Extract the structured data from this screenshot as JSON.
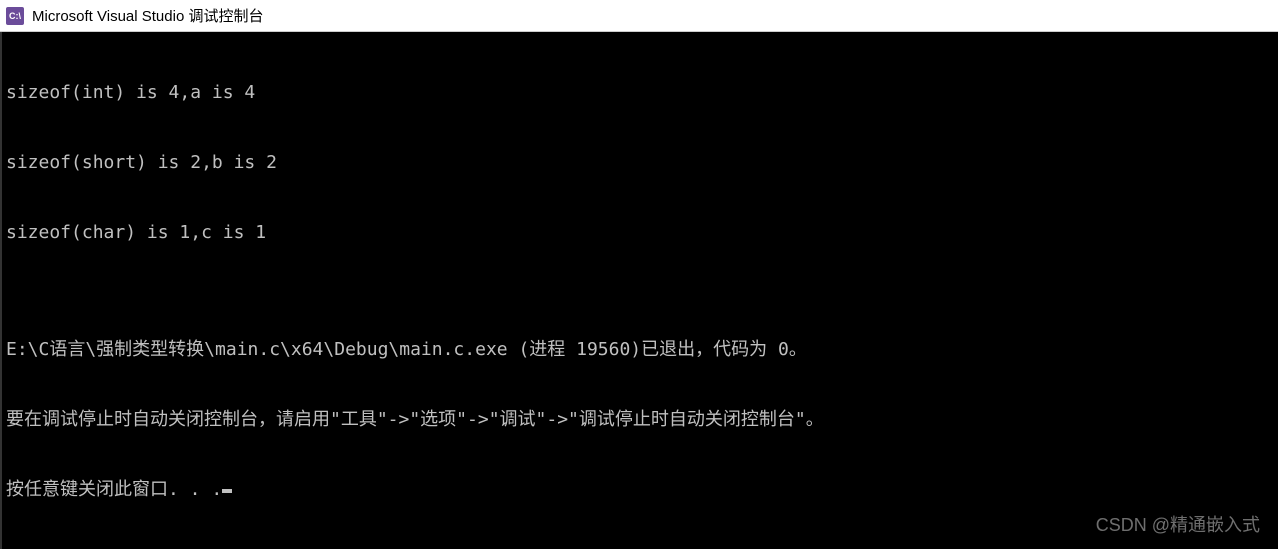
{
  "window": {
    "icon_text": "C:\\",
    "title": "Microsoft Visual Studio 调试控制台"
  },
  "console": {
    "lines": [
      "sizeof(int) is 4,a is 4",
      "sizeof(short) is 2,b is 2",
      "sizeof(char) is 1,c is 1",
      "",
      "E:\\C语言\\强制类型转换\\main.c\\x64\\Debug\\main.c.exe (进程 19560)已退出，代码为 0。",
      "要在调试停止时自动关闭控制台，请启用\"工具\"->\"选项\"->\"调试\"->\"调试停止时自动关闭控制台\"。",
      "按任意键关闭此窗口. . ."
    ]
  },
  "watermark": "CSDN @精通嵌入式"
}
